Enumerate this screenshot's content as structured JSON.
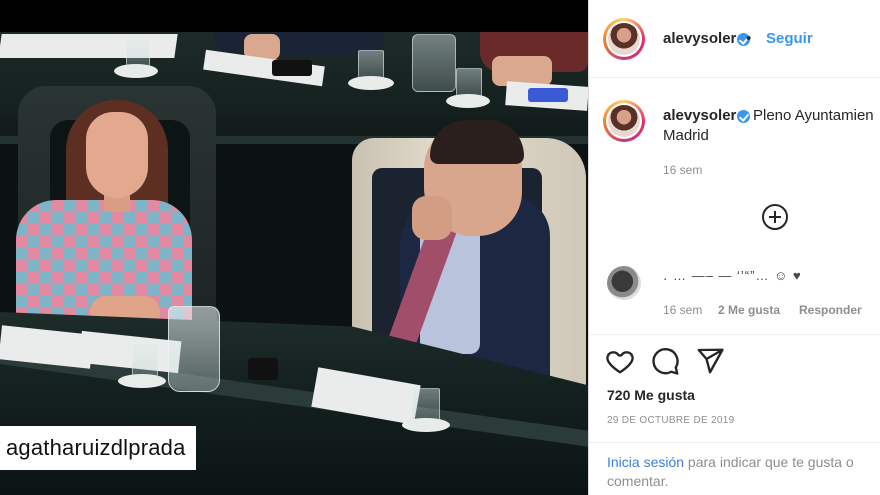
{
  "post": {
    "watermark": "agatharuizdlprada"
  },
  "header": {
    "username": "alevysoler",
    "separator": "•",
    "follow_label": "Seguir"
  },
  "caption": {
    "username": "alevysoler",
    "text_line1": "Pleno Ayuntamien",
    "text_line2": "Madrid",
    "time": "16 sem"
  },
  "load_more_icon": "plus-circle-icon",
  "comment": {
    "text": "․ … ―‒ — ‘’“”… ☺ ♥",
    "time": "16 sem",
    "likes_label": "2 Me gusta",
    "reply_label": "Responder"
  },
  "actions": {
    "like_icon": "heart-icon",
    "comment_icon": "comment-icon",
    "share_icon": "share-icon"
  },
  "likes": "720 Me gusta",
  "date": "29 DE OCTUBRE DE 2019",
  "login": {
    "link": "Inicia sesión",
    "text_line1": " para indicar que te gusta o",
    "text_line2": "comentar."
  },
  "colors": {
    "accent": "#3897f0",
    "text": "#262626",
    "muted": "#8e8e8e"
  }
}
